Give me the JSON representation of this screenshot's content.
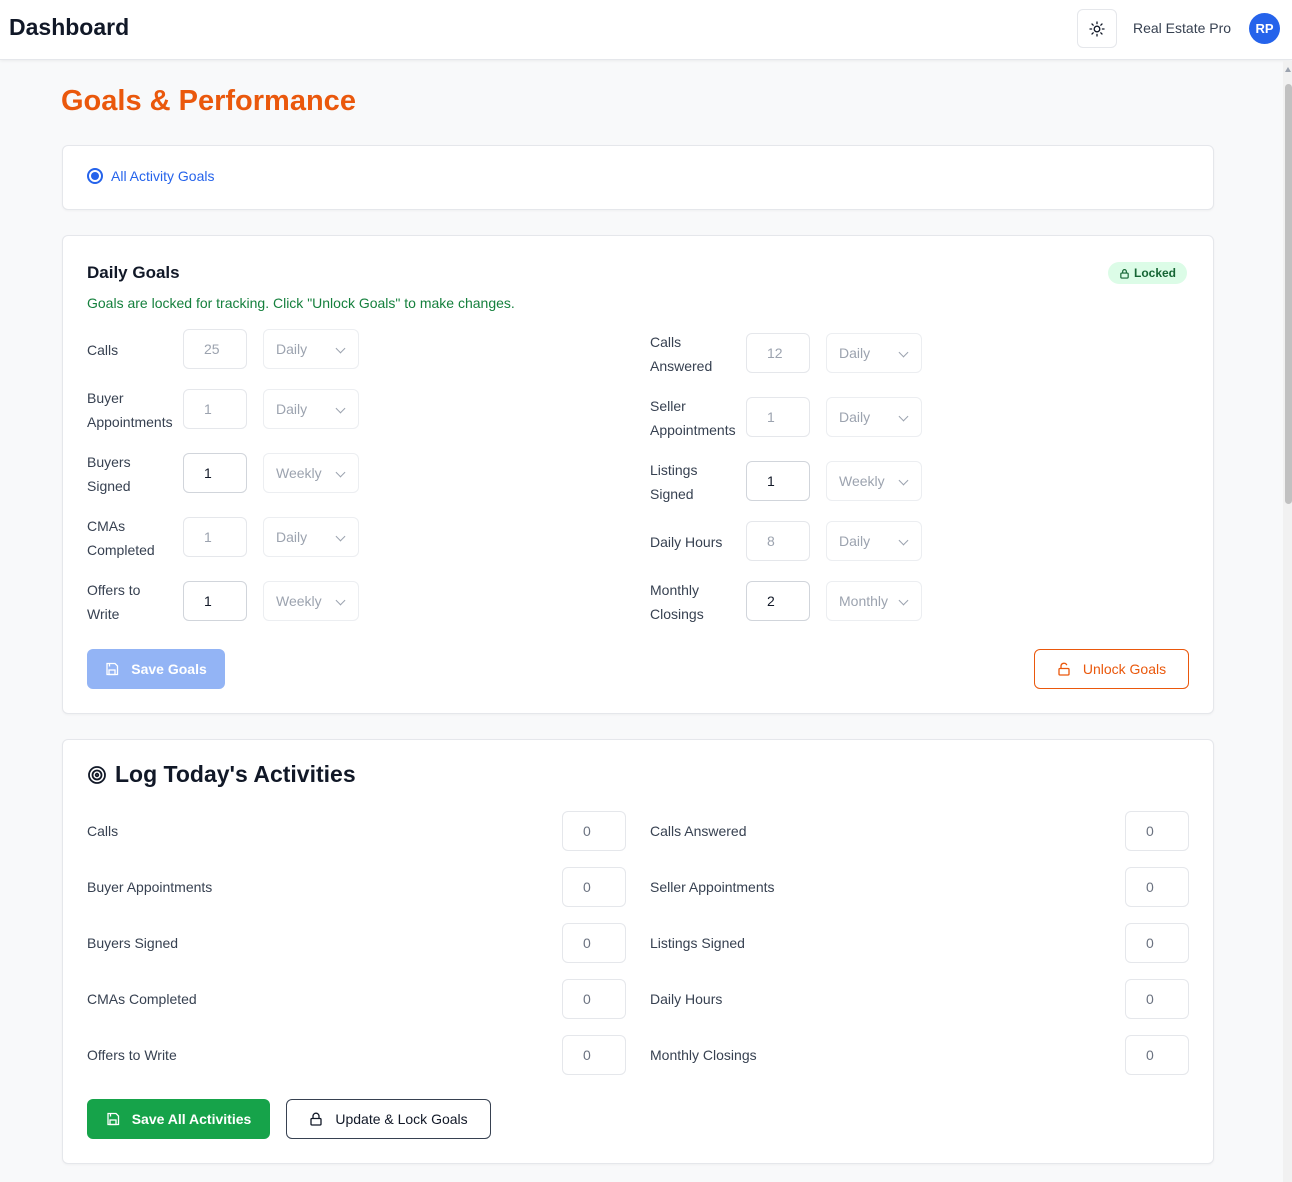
{
  "header": {
    "title": "Dashboard",
    "user_name": "Real Estate Pro",
    "avatar_initials": "RP"
  },
  "page_title": "Goals & Performance",
  "goal_filter": {
    "option_label": "All Activity Goals",
    "selected": true
  },
  "daily_goals": {
    "title": "Daily Goals",
    "status_badge": "Locked",
    "locked_message": "Goals are locked for tracking. Click \"Unlock Goals\" to make changes.",
    "left": [
      {
        "label": "Calls",
        "value": "25",
        "period": "Daily"
      },
      {
        "label": "Buyer Appointments",
        "value": "1",
        "period": "Daily"
      },
      {
        "label": "Buyers Signed",
        "value": "1",
        "period": "Weekly"
      },
      {
        "label": "CMAs Completed",
        "value": "1",
        "period": "Daily"
      },
      {
        "label": "Offers to Write",
        "value": "1",
        "period": "Weekly"
      }
    ],
    "right": [
      {
        "label": "Calls Answered",
        "value": "12",
        "period": "Daily"
      },
      {
        "label": "Seller Appointments",
        "value": "1",
        "period": "Daily"
      },
      {
        "label": "Listings Signed",
        "value": "1",
        "period": "Weekly"
      },
      {
        "label": "Daily Hours",
        "value": "8",
        "period": "Daily"
      },
      {
        "label": "Monthly Closings",
        "value": "2",
        "period": "Monthly"
      }
    ],
    "save_label": "Save Goals",
    "unlock_label": "Unlock Goals"
  },
  "log_activities": {
    "title": "Log Today's Activities",
    "left": [
      {
        "label": "Calls",
        "value": "0"
      },
      {
        "label": "Buyer Appointments",
        "value": "0"
      },
      {
        "label": "Buyers Signed",
        "value": "0"
      },
      {
        "label": "CMAs Completed",
        "value": "0"
      },
      {
        "label": "Offers to Write",
        "value": "0"
      }
    ],
    "right": [
      {
        "label": "Calls Answered",
        "value": "0"
      },
      {
        "label": "Seller Appointments",
        "value": "0"
      },
      {
        "label": "Listings Signed",
        "value": "0"
      },
      {
        "label": "Daily Hours",
        "value": "0"
      },
      {
        "label": "Monthly Closings",
        "value": "0"
      }
    ],
    "save_all_label": "Save All Activities",
    "update_lock_label": "Update & Lock Goals"
  },
  "colors": {
    "accent_orange": "#ea580c",
    "primary_blue": "#2563eb",
    "success_green": "#16a34a"
  }
}
